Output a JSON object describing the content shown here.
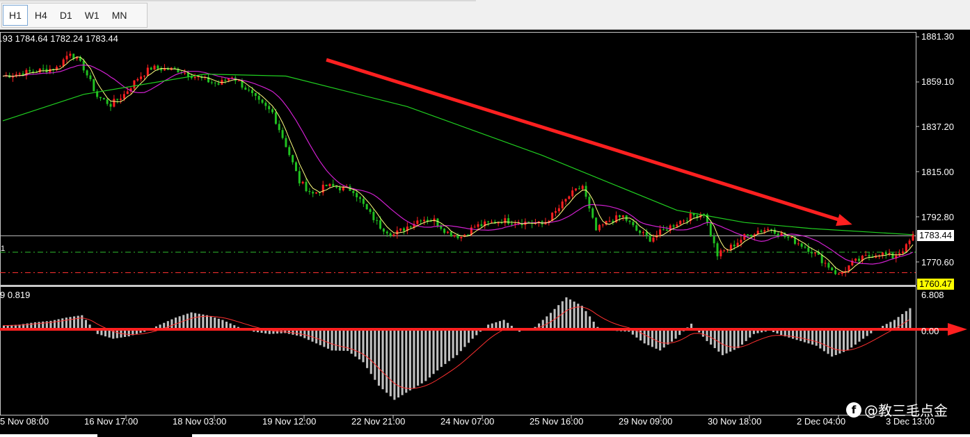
{
  "toolbar": {
    "timeframes": [
      {
        "label": "H1",
        "active": true
      },
      {
        "label": "H4",
        "active": false
      },
      {
        "label": "D1",
        "active": false
      },
      {
        "label": "W1",
        "active": false
      },
      {
        "label": "MN",
        "active": false
      }
    ]
  },
  "price_panel": {
    "ohlc_text": ".93 1784.64 1782.24 1783.44",
    "left_marker": "1",
    "price_ticks": [
      "1881.30",
      "1859.10",
      "1837.20",
      "1815.00",
      "1792.80",
      "1770.60"
    ],
    "current_price": "1783.44",
    "alert_price": "1760.47",
    "colors": {
      "bull": "#ff2020",
      "bear": "#20c020",
      "ma_long": "#20d020",
      "ma_mid": "#d020d0",
      "ma_fast": "#ffff80",
      "trend_arrow": "#ff2020",
      "alert_bg": "#ffff00"
    }
  },
  "macd_panel": {
    "label": "9 0.819",
    "top_value": "6.808",
    "zero_label": "0.00",
    "colors": {
      "histogram": "#c0c0c0",
      "signal": "#ff3030"
    }
  },
  "time_axis": [
    "5 Nov 08:00",
    "16 Nov 17:00",
    "18 Nov 03:00",
    "19 Nov 12:00",
    "22 Nov 21:00",
    "24 Nov 07:00",
    "25 Nov 16:00",
    "29 Nov 09:00",
    "30 Nov 18:00",
    "2 Dec 04:00",
    "3 Dec 13:00"
  ],
  "watermark": {
    "logo": "f",
    "text": "@教三毛点金"
  },
  "chart_data": {
    "type": "line",
    "symbol_timeframe": "H1",
    "y_ticks": [
      1881.3,
      1859.1,
      1837.2,
      1815.0,
      1792.8,
      1770.6
    ],
    "current_price": 1783.44,
    "alert_level": 1760.47,
    "x_labels": [
      "5 Nov 08:00",
      "16 Nov 17:00",
      "18 Nov 03:00",
      "19 Nov 12:00",
      "22 Nov 21:00",
      "24 Nov 07:00",
      "25 Nov 16:00",
      "29 Nov 09:00",
      "30 Nov 18:00",
      "2 Dec 04:00",
      "3 Dec 13:00"
    ],
    "price_path": [
      [
        0,
        1862
      ],
      [
        4,
        1864
      ],
      [
        8,
        1866
      ],
      [
        10,
        1874
      ],
      [
        12,
        1866
      ],
      [
        14,
        1852
      ],
      [
        16,
        1848
      ],
      [
        18,
        1853
      ],
      [
        20,
        1861
      ],
      [
        22,
        1866
      ],
      [
        26,
        1865
      ],
      [
        30,
        1860
      ],
      [
        32,
        1858
      ],
      [
        34,
        1862
      ],
      [
        36,
        1856
      ],
      [
        38,
        1849
      ],
      [
        40,
        1844
      ],
      [
        42,
        1828
      ],
      [
        44,
        1810
      ],
      [
        46,
        1804
      ],
      [
        48,
        1808
      ],
      [
        52,
        1806
      ],
      [
        54,
        1796
      ],
      [
        56,
        1788
      ],
      [
        58,
        1784
      ],
      [
        60,
        1788
      ],
      [
        62,
        1792
      ],
      [
        64,
        1791
      ],
      [
        66,
        1785
      ],
      [
        68,
        1783
      ],
      [
        70,
        1788
      ],
      [
        74,
        1791
      ],
      [
        78,
        1790
      ],
      [
        80,
        1789
      ],
      [
        82,
        1795
      ],
      [
        84,
        1803
      ],
      [
        86,
        1808
      ],
      [
        87,
        1796
      ],
      [
        88,
        1786
      ],
      [
        90,
        1791
      ],
      [
        92,
        1793
      ],
      [
        94,
        1786
      ],
      [
        96,
        1782
      ],
      [
        98,
        1786
      ],
      [
        100,
        1790
      ],
      [
        102,
        1793
      ],
      [
        104,
        1795
      ],
      [
        105,
        1784
      ],
      [
        106,
        1774
      ],
      [
        108,
        1778
      ],
      [
        110,
        1783
      ],
      [
        112,
        1786
      ],
      [
        114,
        1787
      ],
      [
        116,
        1783
      ],
      [
        118,
        1780
      ],
      [
        120,
        1776
      ],
      [
        122,
        1770
      ],
      [
        124,
        1764
      ],
      [
        126,
        1770
      ],
      [
        128,
        1773
      ],
      [
        130,
        1775
      ],
      [
        132,
        1773
      ],
      [
        134,
        1778
      ],
      [
        135,
        1783.44
      ]
    ],
    "ma_long_path": [
      [
        0,
        1840
      ],
      [
        12,
        1853
      ],
      [
        30,
        1863
      ],
      [
        42,
        1862
      ],
      [
        60,
        1847
      ],
      [
        80,
        1823
      ],
      [
        100,
        1796
      ],
      [
        110,
        1790
      ],
      [
        120,
        1787
      ],
      [
        135,
        1784
      ]
    ],
    "trend_line": [
      [
        48,
        1870
      ],
      [
        126,
        1789
      ]
    ],
    "macd_hist": [
      0.8,
      1,
      1.5,
      1.8,
      2.5,
      3,
      -1,
      -2,
      -1.5,
      -0.5,
      1,
      2.5,
      3.6,
      3,
      2,
      0.5,
      -0.5,
      -1,
      -0.8,
      -1.5,
      -3,
      -4.5,
      -4.6,
      -7,
      -12,
      -15,
      -13,
      -11,
      -8,
      -5.5,
      -2,
      1,
      2,
      -0.5,
      0.5,
      3.5,
      6.8,
      5,
      0.5,
      -0.3,
      -0.5,
      -3,
      -4.5,
      -2,
      1.2,
      -2.5,
      -5.5,
      -4,
      -1,
      -0.3,
      -1.5,
      -2.5,
      -3.5,
      -5.8,
      -4.5,
      -2,
      0.3,
      2,
      4.5
    ],
    "macd_zero": 0
  }
}
